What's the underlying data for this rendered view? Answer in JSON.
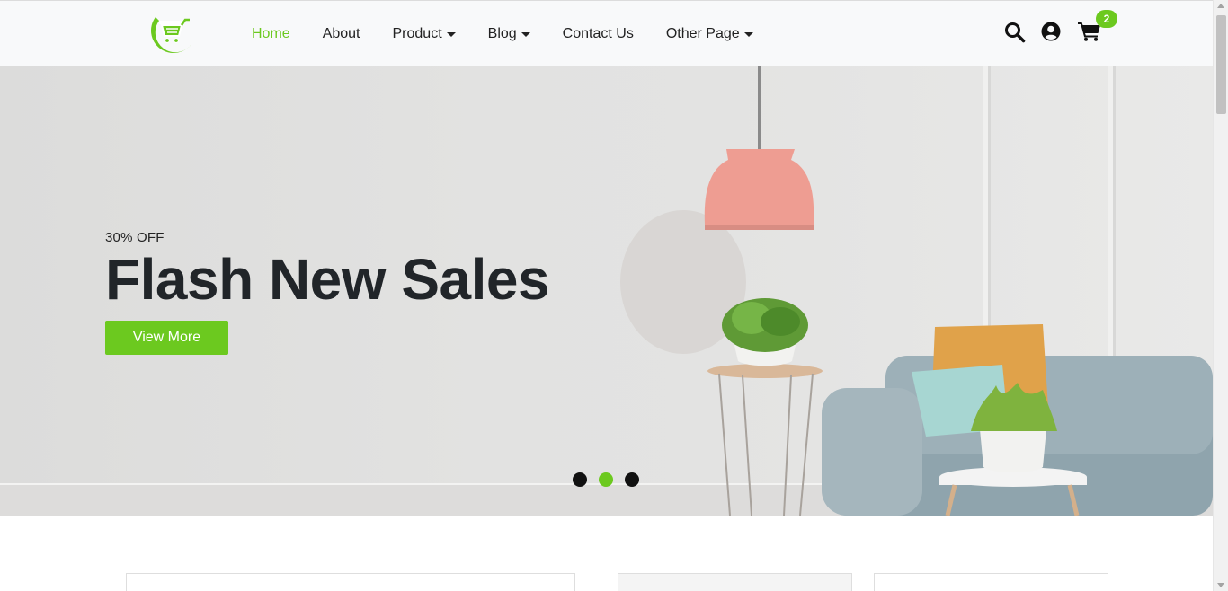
{
  "colors": {
    "accent": "#6cc91f",
    "header_bg": "#f8f9fa",
    "text": "#212529"
  },
  "header": {
    "logo_icon": "shopping-cart-logo",
    "nav": [
      {
        "label": "Home",
        "active": true,
        "dropdown": false
      },
      {
        "label": "About",
        "active": false,
        "dropdown": false
      },
      {
        "label": "Product",
        "active": false,
        "dropdown": true
      },
      {
        "label": "Blog",
        "active": false,
        "dropdown": true
      },
      {
        "label": "Contact Us",
        "active": false,
        "dropdown": false
      },
      {
        "label": "Other Page",
        "active": false,
        "dropdown": true
      }
    ],
    "icons": [
      "search-icon",
      "user-circle-icon",
      "cart-icon"
    ],
    "cart_count": "2"
  },
  "hero": {
    "kicker": "30% OFF",
    "title": "Flash New Sales",
    "button_label": "View More",
    "slides_total": 3,
    "active_slide": 2
  }
}
